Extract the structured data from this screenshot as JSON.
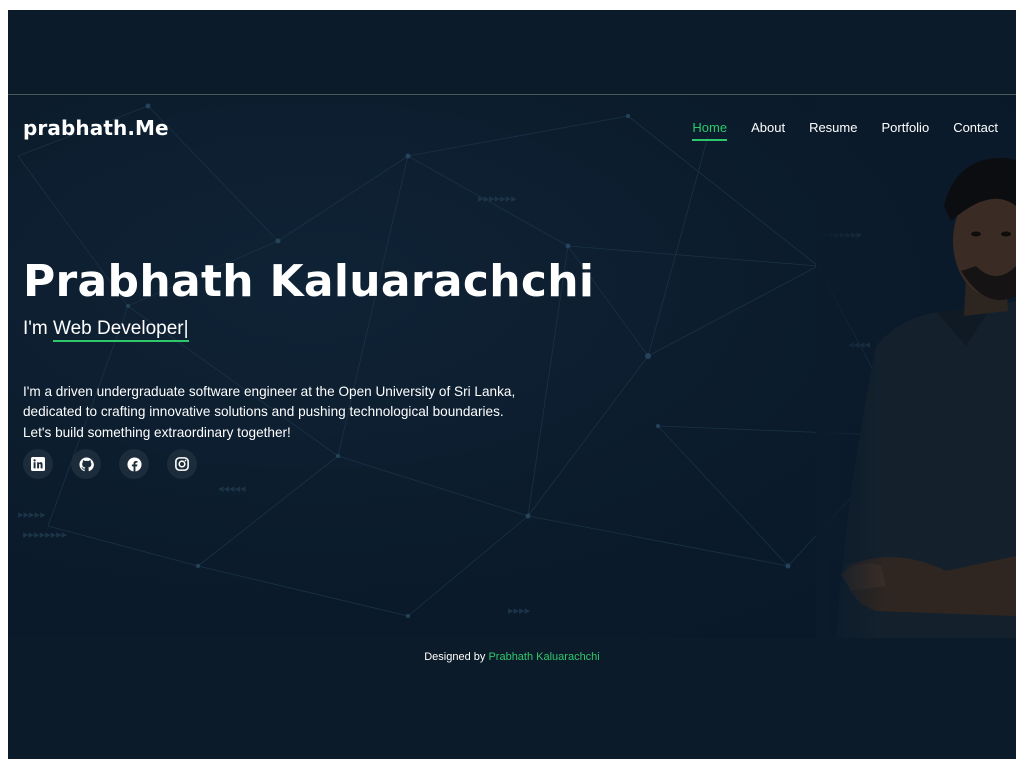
{
  "header": {
    "brand": "prabhath.Me",
    "nav": [
      {
        "label": "Home",
        "active": true
      },
      {
        "label": "About",
        "active": false
      },
      {
        "label": "Resume",
        "active": false
      },
      {
        "label": "Portfolio",
        "active": false
      },
      {
        "label": "Contact",
        "active": false
      }
    ]
  },
  "hero": {
    "title": "Prabhath Kaluarachchi",
    "subtitle_prefix": "I'm",
    "subtitle_typed": "Web Developer",
    "caret": "|",
    "description": "I'm a driven undergraduate software engineer at the Open University of Sri Lanka, dedicated to crafting innovative solutions and pushing technological boundaries. Let's build something extraordinary together!",
    "socials": [
      {
        "icon": "linkedin-icon"
      },
      {
        "icon": "github-icon"
      },
      {
        "icon": "facebook-icon"
      },
      {
        "icon": "instagram-icon"
      }
    ]
  },
  "footer": {
    "prefix": "Designed by",
    "author": "Prabhath Kaluarachchi"
  },
  "colors": {
    "accent": "#2ec86b",
    "background": "#0b1a28"
  }
}
